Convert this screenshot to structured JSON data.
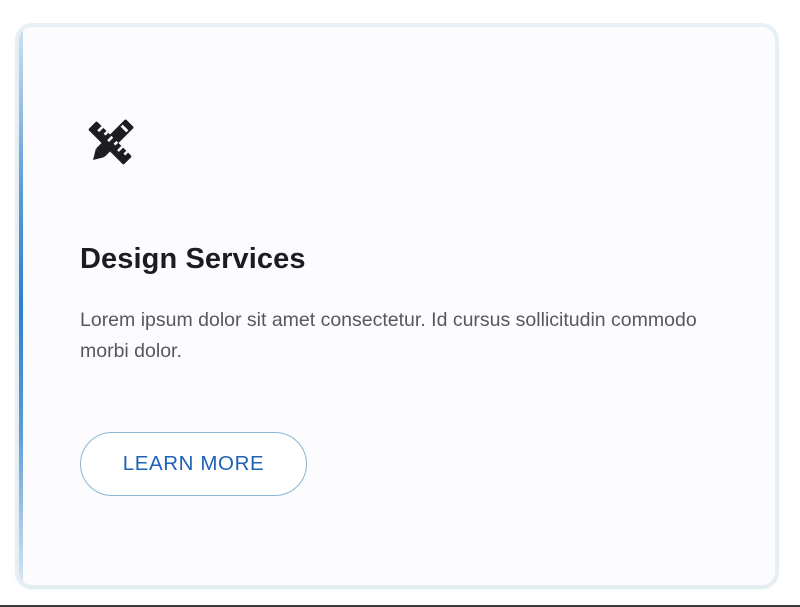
{
  "card": {
    "icon": "design-tools-icon",
    "title": "Design Services",
    "description": "Lorem ipsum dolor sit amet consectetur. Id cursus sollicitudin commodo morbi dolor.",
    "button_label": "LEARN MORE"
  },
  "colors": {
    "accent_bar": "#2f7fd0",
    "button_text": "#1e62b5",
    "button_border": "#8ab5d3",
    "title": "#1c1c1e",
    "body_text": "#58585c",
    "card_background": "#fcfbfd"
  }
}
